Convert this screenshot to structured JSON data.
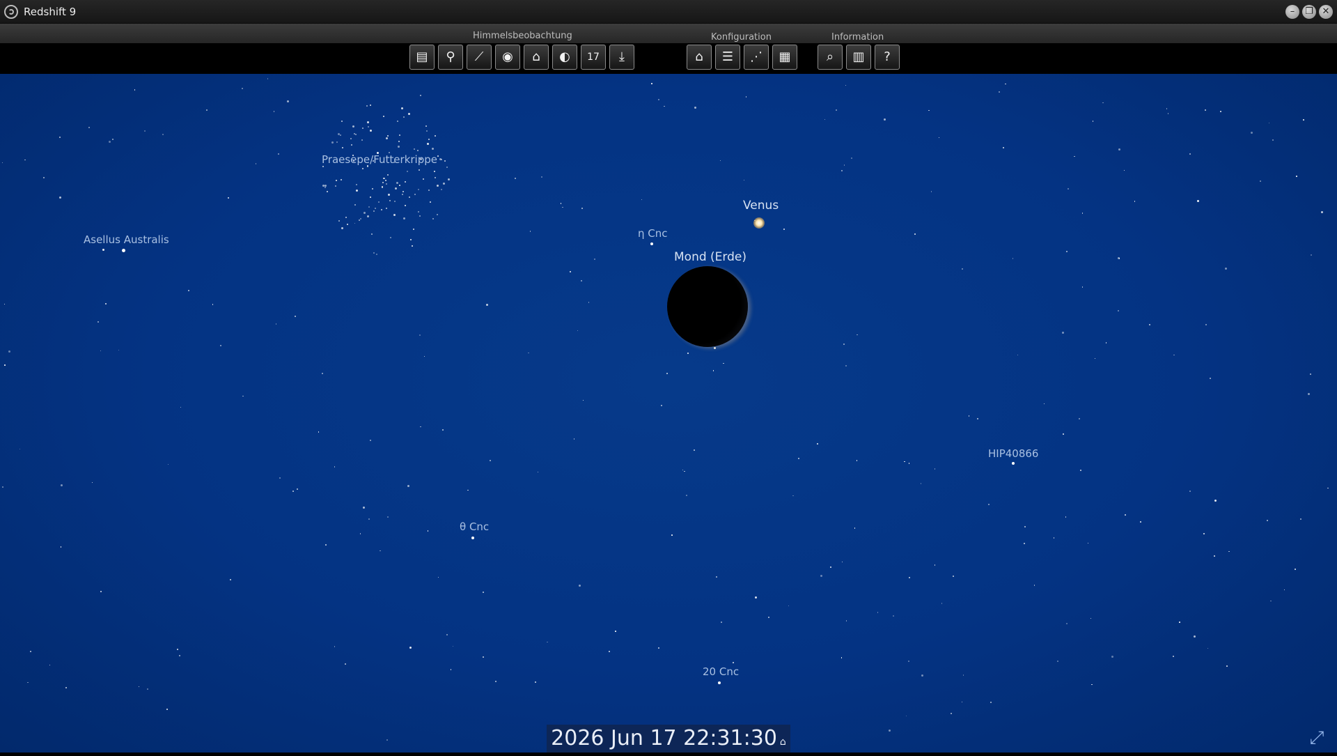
{
  "window": {
    "title": "Redshift 9"
  },
  "toolbar": {
    "groups": [
      {
        "label": "Himmelsbeobachtung"
      },
      {
        "label": "Konfiguration"
      },
      {
        "label": "Information"
      }
    ],
    "buttons": [
      {
        "icon": "save-icon"
      },
      {
        "icon": "location-pin-icon"
      },
      {
        "icon": "telescope-icon"
      },
      {
        "icon": "eye-icon"
      },
      {
        "icon": "observatory-icon"
      },
      {
        "icon": "moon-phase-icon"
      },
      {
        "icon": "calendar-icon",
        "text": "17"
      },
      {
        "icon": "download-pen-icon"
      },
      {
        "icon": "home-icon"
      },
      {
        "icon": "sliders-icon"
      },
      {
        "icon": "constellation-icon"
      },
      {
        "icon": "grid-icon"
      },
      {
        "icon": "search-icon"
      },
      {
        "icon": "book-icon"
      },
      {
        "icon": "help-icon"
      }
    ]
  },
  "sky": {
    "labels": {
      "praesepe": "Praesepe/Futterkrippe",
      "asellus": "Asellus Australis",
      "venus": "Venus",
      "eta_cnc": "η Cnc",
      "moon": "Mond (Erde)",
      "hip": "HIP40866",
      "theta_cnc": "θ Cnc",
      "cnc20": "20 Cnc"
    }
  },
  "datetime": "2026  Jun  17 22:31:30"
}
